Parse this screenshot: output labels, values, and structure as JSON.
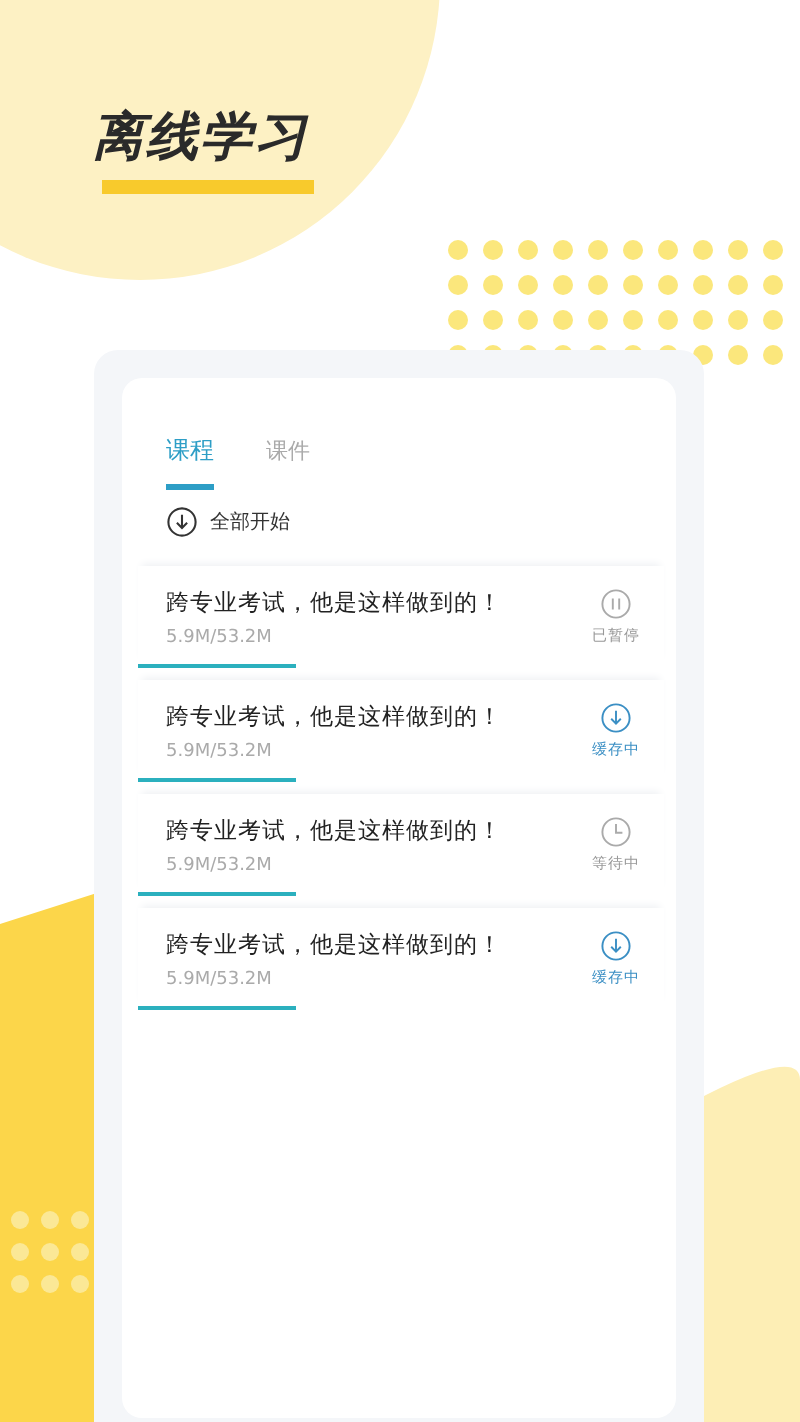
{
  "title": "离线学习",
  "tabs": [
    {
      "label": "课程",
      "selected": true
    },
    {
      "label": "课件",
      "selected": false
    }
  ],
  "start_all": "全部开始",
  "downloads": [
    {
      "title": "跨专业考试，他是这样做到的！",
      "size": "5.9M/53.2M",
      "level": 0.3,
      "kind": "paused",
      "status": "已暂停"
    },
    {
      "title": "跨专业考试，他是这样做到的！",
      "size": "5.9M/53.2M",
      "level": 0.3,
      "kind": "downloading",
      "status": "缓存中"
    },
    {
      "title": "跨专业考试，他是这样做到的！",
      "size": "5.9M/53.2M",
      "level": 0.3,
      "kind": "waiting",
      "status": "等待中"
    },
    {
      "title": "跨专业考试，他是这样做到的！",
      "size": "5.9M/53.2M",
      "level": 0.3,
      "kind": "downloading",
      "status": "缓存中"
    }
  ]
}
